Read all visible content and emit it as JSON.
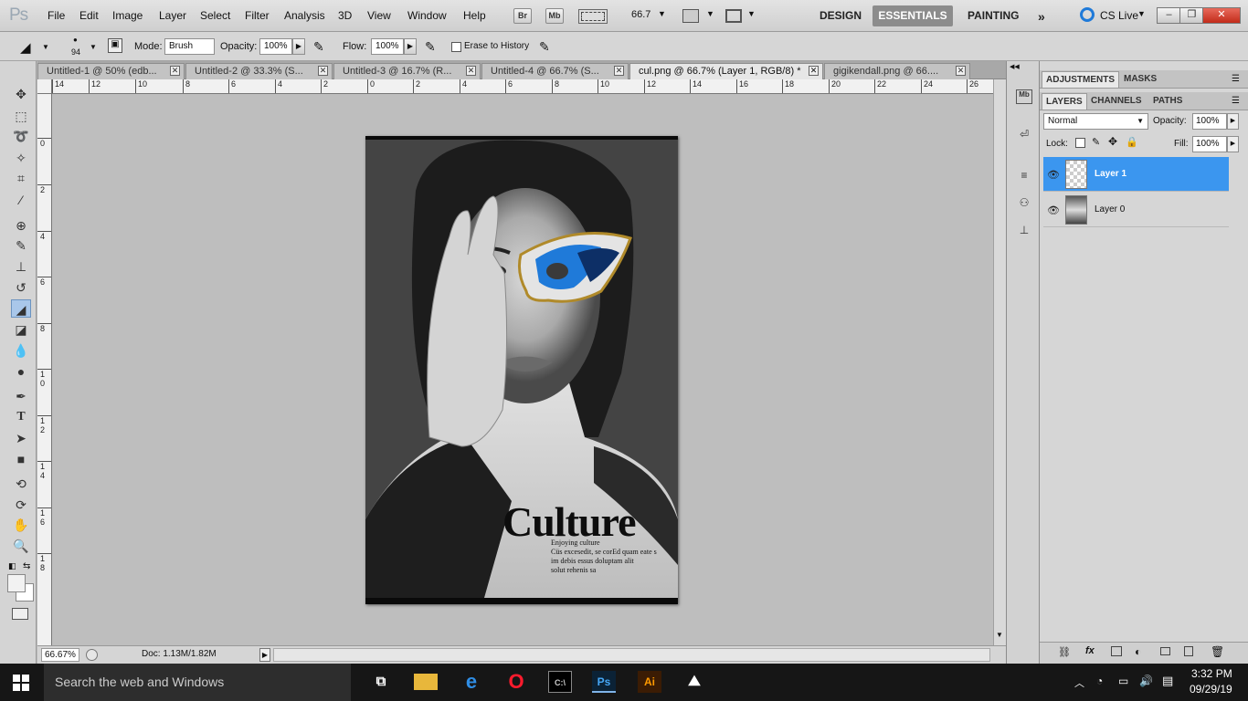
{
  "app": {
    "logo": "Ps",
    "menus": [
      "File",
      "Edit",
      "Image",
      "Layer",
      "Select",
      "Filter",
      "Analysis",
      "3D",
      "View",
      "Window",
      "Help"
    ],
    "bridge_label": "Br",
    "minibridge_label": "Mb",
    "zoom_value": "66.7",
    "workspaces": [
      "DESIGN",
      "ESSENTIALS",
      "PAINTING"
    ],
    "active_workspace": "ESSENTIALS",
    "cs_live": "CS Live"
  },
  "options": {
    "brush_size": "94",
    "mode_label": "Mode:",
    "mode_value": "Brush",
    "opacity_label": "Opacity:",
    "opacity_value": "100%",
    "flow_label": "Flow:",
    "flow_value": "100%",
    "erase_history_label": "Erase to History"
  },
  "tabs": [
    {
      "label": "Untitled-1 @ 50% (edb...",
      "active": false
    },
    {
      "label": "Untitled-2 @ 33.3% (S...",
      "active": false
    },
    {
      "label": "Untitled-3 @ 16.7% (R...",
      "active": false
    },
    {
      "label": "Untitled-4 @ 66.7% (S...",
      "active": false
    },
    {
      "label": "cul.png @ 66.7% (Layer 1, RGB/8) *",
      "active": true
    },
    {
      "label": "gigikendall.png @ 66....",
      "active": false
    }
  ],
  "ruler": {
    "h_ticks": [
      "14",
      "12",
      "10",
      "8",
      "6",
      "4",
      "2",
      "0",
      "2",
      "4",
      "6",
      "8",
      "10",
      "12",
      "14",
      "16",
      "18",
      "20",
      "22",
      "24",
      "26"
    ],
    "v_ticks": [
      "0",
      "2",
      "4",
      "6",
      "8",
      "1 0",
      "1 2",
      "1 4",
      "1 6",
      "1 8"
    ]
  },
  "poster": {
    "title": "Culture",
    "line1": "Enjoying culture",
    "line2": "Cüs excesedit, se corEd quam eate s",
    "line3": "im debis essus doluptam alit",
    "line4": "solut rehenis sa"
  },
  "status": {
    "zoom": "66.67%",
    "doc": "Doc: 1.13M/1.82M"
  },
  "panels": {
    "top_tabs": [
      "ADJUSTMENTS",
      "MASKS"
    ],
    "layer_tabs": [
      "LAYERS",
      "CHANNELS",
      "PATHS"
    ],
    "blend_mode": "Normal",
    "opacity_label": "Opacity:",
    "opacity_value": "100%",
    "lock_label": "Lock:",
    "fill_label": "Fill:",
    "fill_value": "100%",
    "layers": [
      {
        "name": "Layer 1",
        "selected": true
      },
      {
        "name": "Layer 0",
        "selected": false
      }
    ]
  },
  "taskbar": {
    "search_placeholder": "Search the web and Windows",
    "time": "3:32 PM",
    "date": "09/29/19"
  },
  "colors": {
    "selection": "#3b96ef",
    "mask_blue": "#1f7ad9",
    "taskbar": "#161616"
  }
}
